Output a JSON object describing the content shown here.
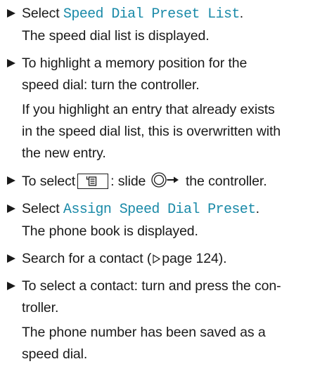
{
  "steps": [
    {
      "prefix": "Select ",
      "menu": "Speed Dial Preset List",
      "suffix": ".",
      "result": "The speed dial list is displayed."
    },
    {
      "line1": "To highlight a memory position for the",
      "line2": "speed dial: turn the controller.",
      "note1": "If you highlight an entry that already exists",
      "note2": "in the speed dial list, this is overwritten with",
      "note3": "the new entry."
    },
    {
      "prefix": "To select",
      "middle": ": slide",
      "suffix": "the controller.",
      "softkey_icon": "phonebook-softkey-icon",
      "controller_icon": "controller-slide-right-icon"
    },
    {
      "prefix": "Select ",
      "menu": "Assign Speed Dial Preset",
      "suffix": ".",
      "result": "The phone book is displayed."
    },
    {
      "prefix": "Search for a contact (",
      "page_ref": "page 124",
      "suffix": ").",
      "ref_icon": "page-reference-triangle-icon"
    },
    {
      "line1": "To select a contact: turn and press the con-",
      "line2": "troller.",
      "result1": "The phone number has been saved as a",
      "result2": "speed dial."
    }
  ],
  "colors": {
    "text": "#1a1a1a",
    "menu_highlight": "#1a8aa8"
  }
}
